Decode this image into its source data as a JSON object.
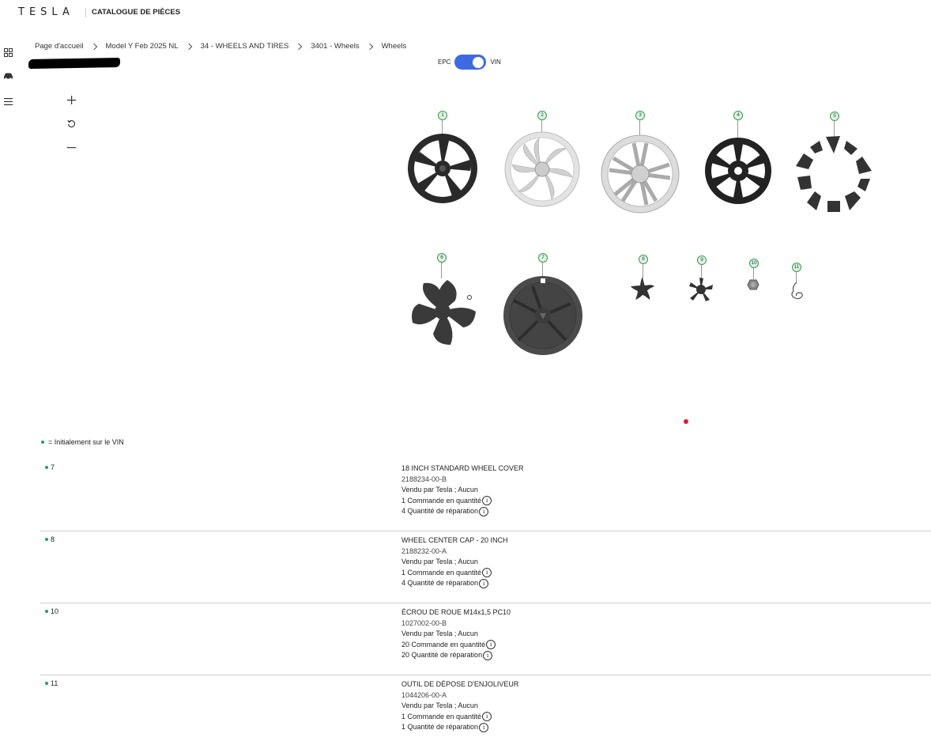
{
  "header": {
    "logo": "TESLA",
    "title": "CATALOGUE DE PIÈCES"
  },
  "breadcrumb": [
    "Page d'accueil",
    "Model Y Feb 2025 NL",
    "34 - WHEELS AND TIRES",
    "3401 - Wheels",
    "Wheels"
  ],
  "toggle": {
    "left": "EPC",
    "right": "VIN"
  },
  "callouts": [
    "1",
    "2",
    "3",
    "4",
    "5",
    "6",
    "7",
    "8",
    "9",
    "10",
    "11"
  ],
  "legend": "= Initialement sur le VIN",
  "parts": [
    {
      "num": "7",
      "name": "18 INCH STANDARD WHEEL COVER",
      "pn": "2188234-00-B",
      "sold": "Vendu par Tesla ; Aucun",
      "order": "1 Commande en quantité",
      "repair": "4 Quantité de réparation"
    },
    {
      "num": "8",
      "name": "WHEEL CENTER CAP - 20 INCH",
      "pn": "2188232-00-A",
      "sold": "Vendu par Tesla ; Aucun",
      "order": "1 Commande en quantité",
      "repair": "4 Quantité de réparation"
    },
    {
      "num": "10",
      "name": "ÉCROU DE ROUE M14x1,5 PC10",
      "pn": "1027002-00-B",
      "sold": "Vendu par Tesla ; Aucun",
      "order": "20 Commande en quantité",
      "repair": "20 Quantité de réparation"
    },
    {
      "num": "11",
      "name": "OUTIL DE DÉPOSE D'ENJOLIVEUR",
      "pn": "1044206-00-A",
      "sold": "Vendu par Tesla ; Aucun",
      "order": "1 Commande en quantité",
      "repair": "1 Quantité de réparation"
    }
  ],
  "colors": {
    "accent": "#3e6ae1",
    "vin_dot": "#1fa34a",
    "marker": "#e31937"
  },
  "icons": {
    "info": "i"
  }
}
